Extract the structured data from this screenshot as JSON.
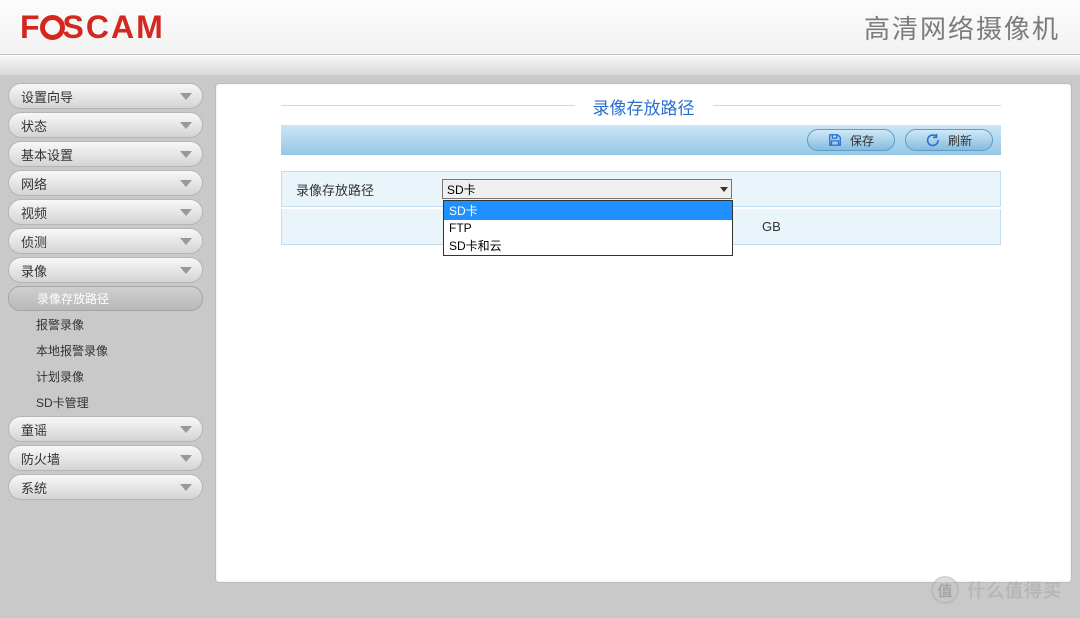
{
  "header": {
    "logo": "FOSCAM",
    "title": "高清网络摄像机"
  },
  "sidebar": {
    "categories": [
      {
        "label": "设置向导",
        "sub": []
      },
      {
        "label": "状态",
        "sub": []
      },
      {
        "label": "基本设置",
        "sub": []
      },
      {
        "label": "网络",
        "sub": []
      },
      {
        "label": "视频",
        "sub": []
      },
      {
        "label": "侦测",
        "sub": []
      },
      {
        "label": "录像",
        "sub": [
          {
            "label": "录像存放路径",
            "active": true
          },
          {
            "label": "报警录像",
            "active": false
          },
          {
            "label": "本地报警录像",
            "active": false
          },
          {
            "label": "计划录像",
            "active": false
          },
          {
            "label": "SD卡管理",
            "active": false
          }
        ]
      },
      {
        "label": "童谣",
        "sub": []
      },
      {
        "label": "防火墙",
        "sub": []
      },
      {
        "label": "系统",
        "sub": []
      }
    ]
  },
  "page": {
    "title": "录像存放路径",
    "toolbar": {
      "save": "保存",
      "refresh": "刷新"
    },
    "form": {
      "path_label": "录像存放路径",
      "selected": "SD卡",
      "options": [
        "SD卡",
        "FTP",
        "SD卡和云"
      ],
      "extra_suffix": "GB"
    }
  },
  "watermark": {
    "icon": "值",
    "text": "什么值得买"
  }
}
